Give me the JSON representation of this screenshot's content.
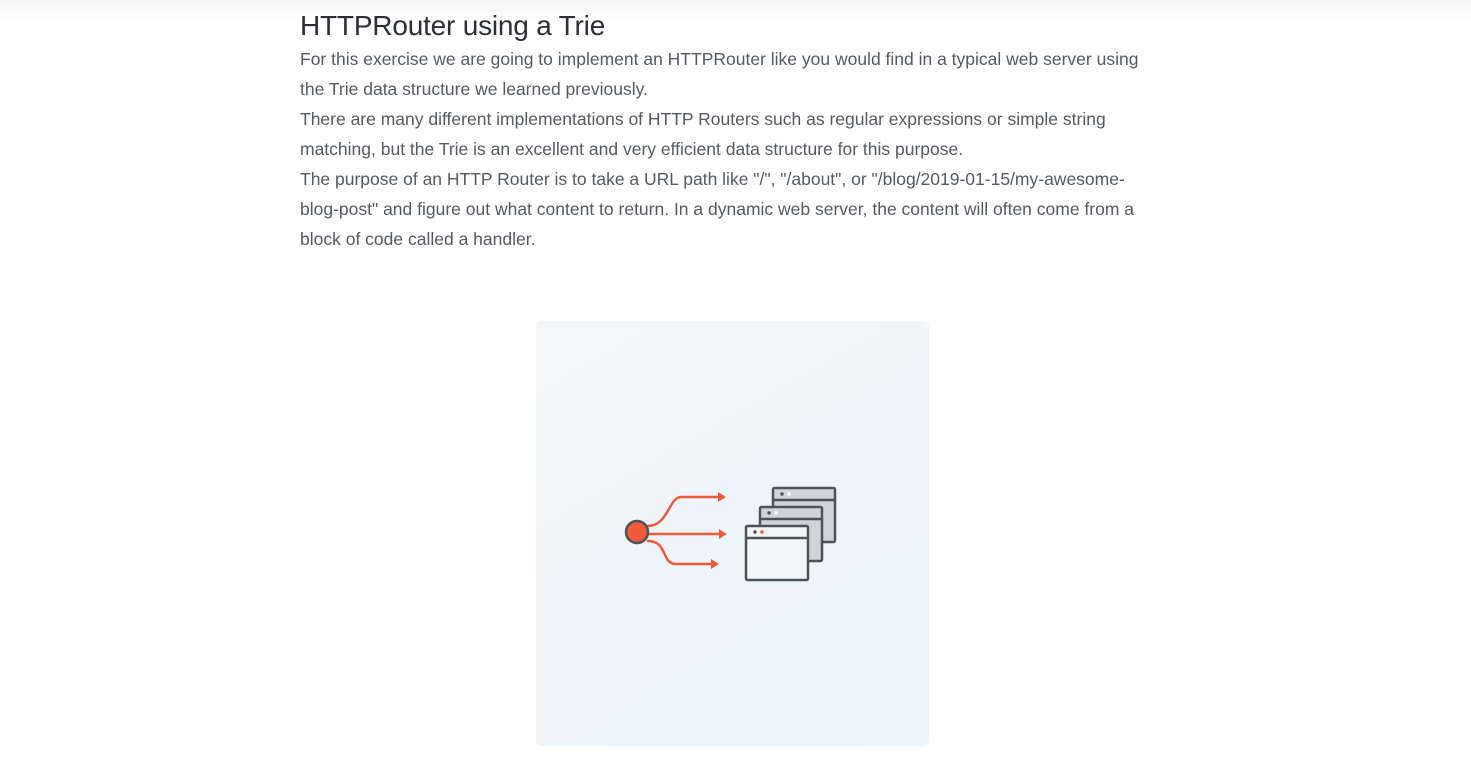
{
  "section": {
    "title": "HTTPRouter using a Trie",
    "paragraphs": [
      "For this exercise we are going to implement an HTTPRouter like you would find in a typical web server using the Trie data structure we learned previously.",
      "There are many different implementations of HTTP Routers such as regular expressions or simple string matching, but the Trie is an excellent and very efficient data structure for this purpose.",
      "The purpose of an HTTP Router is to take a URL path like \"/\", \"/about\", or \"/blog/2019-01-15/my-awesome-blog-post\" and figure out what content to return. In a dynamic web server, the content will often come from a block of code called a handler."
    ]
  },
  "illustration": {
    "icon": "router-routing-to-pages-icon",
    "colors": {
      "accent": "#f05a3c",
      "stroke": "#4d5257",
      "page_back": "#cfd4d9",
      "page_front": "#f4f5f6"
    }
  }
}
